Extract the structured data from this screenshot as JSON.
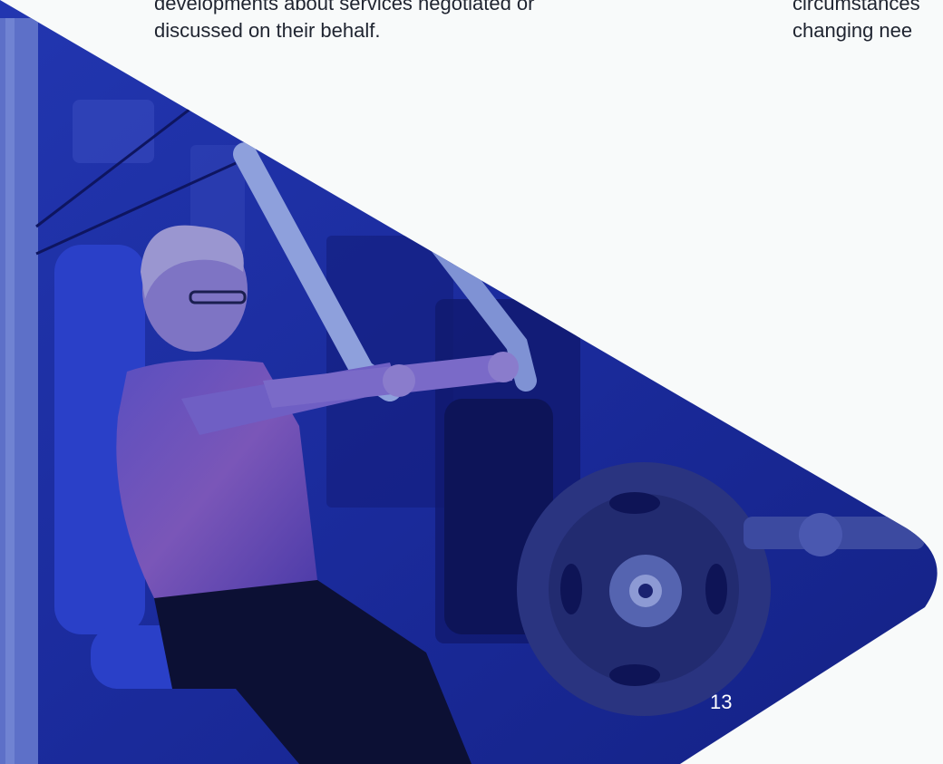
{
  "left_column": {
    "lines": [
      "developments about services negotiated or",
      "discussed on their behalf."
    ]
  },
  "right_column": {
    "lines": [
      "circumstances",
      "changing nee"
    ]
  },
  "photo": {
    "tint_color": "#1a2a9a"
  },
  "page_number": "13"
}
